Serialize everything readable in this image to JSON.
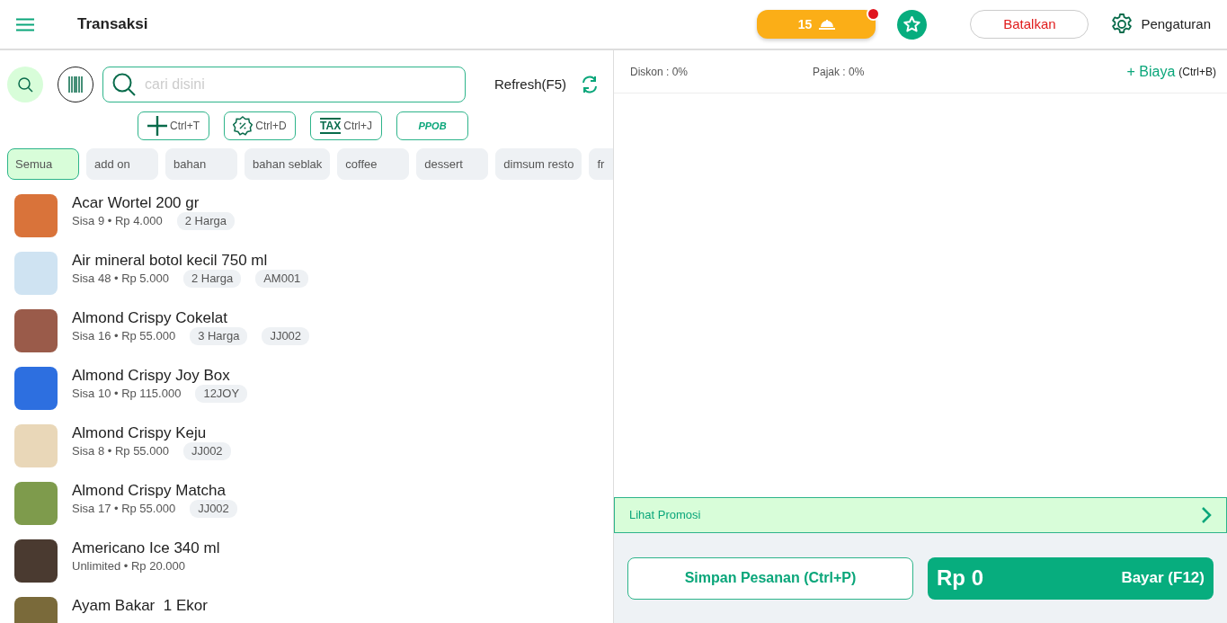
{
  "header": {
    "title": "Transaksi",
    "order_count": "15",
    "order_alert": true,
    "cancel": "Batalkan",
    "settings": "Pengaturan"
  },
  "search": {
    "placeholder": "cari disini",
    "refresh": "Refresh(F5)"
  },
  "shortcuts": [
    {
      "kind": "add",
      "label": "Ctrl+T"
    },
    {
      "kind": "discount",
      "label": "Ctrl+D"
    },
    {
      "kind": "tax",
      "label": "Ctrl+J",
      "icon_text": "TAX"
    },
    {
      "kind": "ppob",
      "label": "PPOB"
    }
  ],
  "categories": [
    {
      "label": "Semua",
      "selected": true
    },
    {
      "label": "add on",
      "selected": false
    },
    {
      "label": "bahan",
      "selected": false
    },
    {
      "label": "bahan seblak",
      "selected": false
    },
    {
      "label": "coffee",
      "selected": false
    },
    {
      "label": "dessert",
      "selected": false
    },
    {
      "label": "dimsum resto",
      "selected": false
    },
    {
      "label": "fr",
      "selected": false
    }
  ],
  "products": [
    {
      "name": "Acar Wortel 200 gr",
      "info": "Sisa 9 • Rp 4.000",
      "tags": [
        "2 Harga"
      ]
    },
    {
      "name": "Air mineral botol kecil 750 ml",
      "info": "Sisa 48 • Rp 5.000",
      "tags": [
        "2 Harga",
        "AM001"
      ]
    },
    {
      "name": "Almond Crispy Cokelat",
      "info": "Sisa 16 • Rp 55.000",
      "tags": [
        "3 Harga",
        "JJ002"
      ]
    },
    {
      "name": "Almond Crispy Joy Box",
      "info": "Sisa 10 • Rp 115.000",
      "tags": [
        "12JOY"
      ]
    },
    {
      "name": "Almond Crispy Keju",
      "info": "Sisa 8 • Rp 55.000",
      "tags": [
        "JJ002"
      ]
    },
    {
      "name": "Almond Crispy Matcha",
      "info": "Sisa 17 • Rp 55.000",
      "tags": [
        "JJ002"
      ]
    },
    {
      "name": "Americano Ice 340 ml",
      "info": "Unlimited • Rp 20.000"
    },
    {
      "name": "Ayam Bakar  1 Ekor"
    }
  ],
  "order": {
    "discount": "Diskon : 0%",
    "tax": "Pajak : 0%",
    "add_fee": "+ Biaya",
    "add_fee_key": "(Ctrl+B)",
    "promo": "Lihat Promosi",
    "save": "Simpan Pesanan (Ctrl+P)",
    "total": "Rp 0",
    "pay": "Bayar (F12)"
  }
}
